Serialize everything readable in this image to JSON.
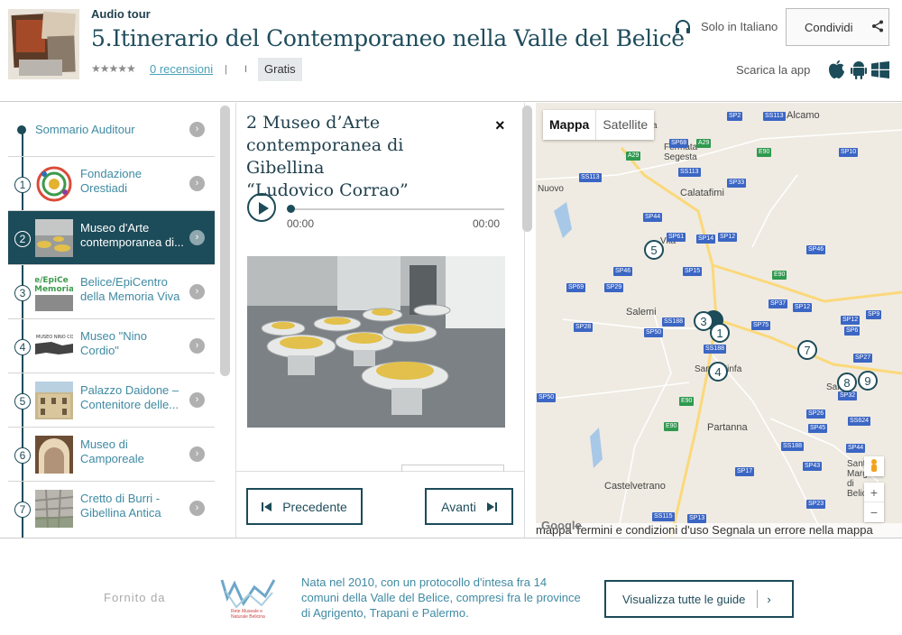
{
  "header": {
    "kicker": "Audio tour",
    "title": "5.Itinerario del Contemporaneo nella Valle del Belice",
    "stars": "★★★★★",
    "reviews": "0 recensioni",
    "separator1": "|",
    "separator2": "I",
    "price": "Gratis",
    "language": "Solo in Italiano",
    "share": "Condividi",
    "get_app": "Scarica la app"
  },
  "sidebar": {
    "summary": "Sommario Auditour",
    "items": [
      {
        "num": "1",
        "label": "Fondazione Orestiadi"
      },
      {
        "num": "2",
        "label": "Museo d'Arte contemporanea di..."
      },
      {
        "num": "3",
        "label": "Belice/EpiCentro della Memoria Viva"
      },
      {
        "num": "4",
        "label": "Museo \"Nino Cordio\""
      },
      {
        "num": "5",
        "label": "Palazzo Daidone – Contenitore delle..."
      },
      {
        "num": "6",
        "label": "Museo di Camporeale"
      },
      {
        "num": "7",
        "label": "Cretto di Burri - Gibellina Antica"
      }
    ],
    "thumb_texts": {
      "epicentro": "e/EpiCe Memoria",
      "cordio": "MUSEO NINO CO"
    }
  },
  "detail": {
    "title_line1": "2 Museo d’Arte",
    "title_line2": "contemporanea di Gibellina",
    "title_line3": "“Ludovico Corrao”",
    "close": "×",
    "time_start": "00:00",
    "time_end": "00:00",
    "prev": "Precedente",
    "next": "Avanti"
  },
  "map": {
    "tab_map": "Mappa",
    "tab_satellite": "Satellite",
    "towns": [
      "Alcamo",
      "Fermata Segesta",
      "Calatafimi",
      "Nuovo",
      "Salemi",
      "Santa Ninfa",
      "Sal",
      "Partanna",
      "Castelvetrano",
      "Sant Marghe di Belice",
      "Vita",
      "ca"
    ],
    "roads": [
      "SP2",
      "SS113",
      "SP68",
      "A29",
      "A29",
      "E90",
      "SP10",
      "SS113",
      "SP33",
      "SS113",
      "SP44",
      "SP61",
      "SP14",
      "SP12",
      "SP46",
      "SP15",
      "E90",
      "SP69",
      "SP29",
      "SP46",
      "SP37",
      "SP12",
      "SP12",
      "SP9",
      "SP28",
      "SS188",
      "SP75",
      "SP6",
      "SP50",
      "SS188",
      "SP27",
      "SP50",
      "E90",
      "SP32",
      "SP26",
      "SS624",
      "E90",
      "SP45",
      "SS188",
      "SP44",
      "SP17",
      "SP43",
      "SS115",
      "SP13",
      "SP23"
    ],
    "markers": [
      "1",
      "3",
      "4",
      "5",
      "7",
      "8",
      "9"
    ],
    "zoom_in": "+",
    "zoom_out": "−",
    "footer": "mappa  Termini e condizioni d'uso   Segnala un errore nella mappa",
    "google": "Google"
  },
  "footer": {
    "provided_by": "Fornito da",
    "logo_text": "Rete Museale e Naturale Belicina",
    "about": "Nata nel 2010, con un protocollo d'intesa fra 14 comuni della Valle del Belice, compresi fra le province di Agrigento, Trapani e Palermo.",
    "all_guides": "Visualizza tutte le guide",
    "chevron": "›"
  },
  "colors": {
    "accent": "#1c4b59",
    "link": "#3f8aa3"
  }
}
